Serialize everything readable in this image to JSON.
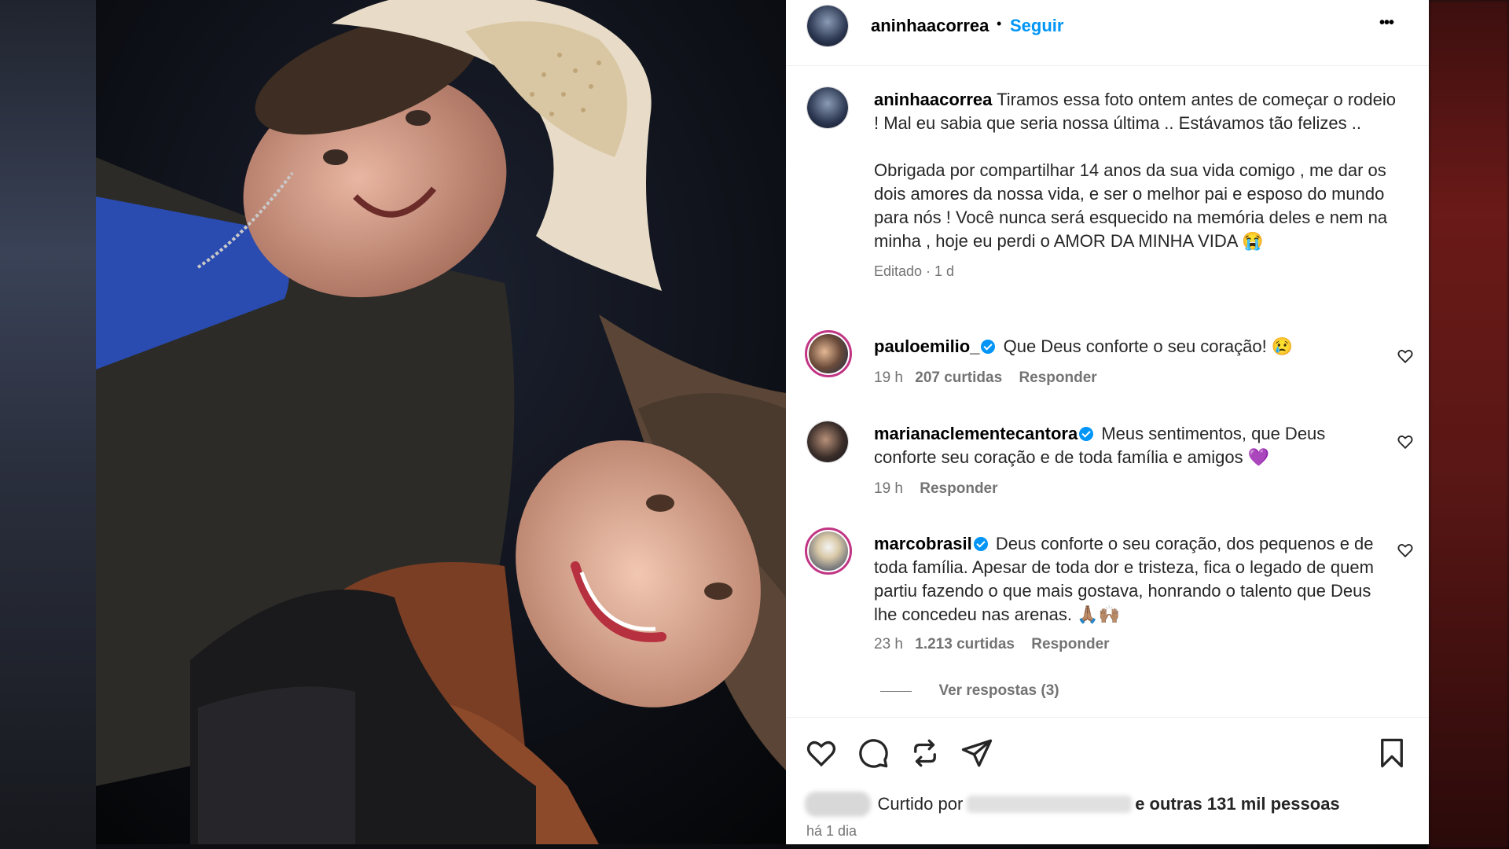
{
  "post": {
    "username": "aninhaacorrea",
    "follow_label": "Seguir",
    "separator": "•",
    "more_label": "•••"
  },
  "caption": {
    "username": "aninhaacorrea",
    "paragraph1": "Tiramos essa foto ontem antes de começar o rodeio ! Mal eu sabia que seria nossa última .. Estávamos tão felizes ..",
    "paragraph2": "Obrigada por compartilhar 14 anos da sua vida comigo , me dar os dois amores da nossa vida, e ser o melhor pai e esposo do mundo para nós ! Você nunca será esquecido na memória deles e nem na minha , hoje eu perdi o AMOR DA MINHA VIDA 😭",
    "edited": "Editado · 1 d"
  },
  "comments": [
    {
      "username": "pauloemilio_",
      "verified": true,
      "text": "Que Deus conforte o seu coração! 😢",
      "time": "19 h",
      "likes": "207 curtidas",
      "reply": "Responder"
    },
    {
      "username": "marianaclementecantora",
      "verified": true,
      "text": "Meus sentimentos, que Deus conforte seu coração e de toda família e amigos 💜",
      "time": "19 h",
      "likes": "",
      "reply": "Responder"
    },
    {
      "username": "marcobrasil",
      "verified": true,
      "text": "Deus conforte o seu coração, dos pequenos e de toda família. Apesar de toda dor e tristeza, fica o legado de quem partiu fazendo o que mais gostava, honrando o talento que Deus lhe concedeu nas arenas. 🙏🏽🙌🏽",
      "time": "23 h",
      "likes": "1.213 curtidas",
      "reply": "Responder"
    }
  ],
  "view_replies": "Ver respostas (3)",
  "likes_summary": {
    "prefix": "Curtido por",
    "suffix": "e outras 131 mil pessoas"
  },
  "timestamp": "há 1 dia",
  "icons": {
    "like": "heart-icon",
    "comment": "comment-icon",
    "repost": "repost-icon",
    "share": "share-icon",
    "save": "bookmark-icon"
  },
  "colors": {
    "follow": "#0095f6",
    "verified": "#0095f6",
    "ring": "#c13584"
  }
}
